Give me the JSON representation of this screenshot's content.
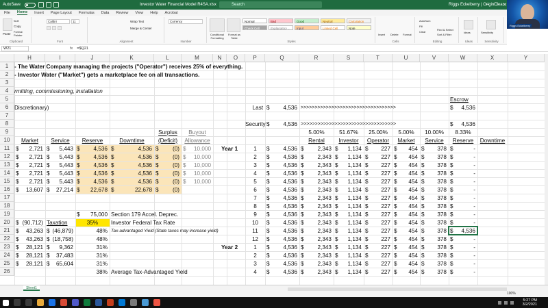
{
  "titlebar": {
    "autosave": "AutoSave",
    "title": "Investor Water Financial Model R4SA.xlsx",
    "search": "Search",
    "user": "Riggs Eckelberry | OriginClear"
  },
  "ribbon": {
    "tabs": [
      "File",
      "Home",
      "Insert",
      "Page Layout",
      "Formulas",
      "Data",
      "Review",
      "View",
      "Help",
      "Acrobat"
    ],
    "groups": [
      "Clipboard",
      "Font",
      "Alignment",
      "Number",
      "Styles",
      "Cells",
      "Editing",
      "Ideas",
      "Sensitivity"
    ],
    "clipboard": {
      "paste": "Paste",
      "cut": "Cut",
      "copy": "Copy",
      "format_painter": "Format Painter"
    },
    "font": {
      "name": "Calibri",
      "size": "11"
    },
    "alignment": {
      "wrap": "Wrap Text",
      "merge": "Merge & Center"
    },
    "number": {
      "format": "Currency"
    },
    "styles": {
      "cond": "Conditional Formatting",
      "table": "Format as Table",
      "normal": "Normal",
      "bad": "Bad",
      "good": "Good",
      "neutral": "Neutral",
      "calculation": "Calculation",
      "check": "Check Cell",
      "explanatory": "Explanatory ...",
      "input": "Input",
      "linked": "Linked Cell",
      "note": "Note"
    },
    "cells": {
      "insert": "Insert",
      "delete": "Delete",
      "format": "Format"
    },
    "editing": {
      "autosum": "AutoSum",
      "fill": "Fill",
      "clear": "Clear",
      "sort": "Sort & Filter",
      "find": "Find & Select"
    },
    "ideas": "Ideas",
    "sensitivity": "Sensitivity"
  },
  "avatar_tag": "Riggs Eckelberry",
  "formula_bar": {
    "name_box": "W21",
    "fx": "fx",
    "formula": "=$Q21"
  },
  "columns": [
    "H",
    "I",
    "J",
    "K",
    "L",
    "M",
    "N",
    "O",
    "P",
    "Q",
    "R",
    "S",
    "T",
    "U",
    "V",
    "W",
    "X",
    "Y"
  ],
  "rows": [
    "1",
    "2",
    "3",
    "4",
    "5",
    "6",
    "7",
    "8",
    "9",
    "10",
    "11",
    "12",
    "13",
    "14",
    "15",
    "16",
    "17",
    "18",
    "19",
    "20",
    "21",
    "22",
    "23",
    "24",
    "25",
    "26"
  ],
  "text": {
    "r1": "- The Water Company managing the projects (\"Operator\") receives 25% of everything.",
    "r2": "- Investor Water (\"Market\") gets a marketplace fee on all transactions.",
    "r4": "rmitting, commissioning, installation",
    "r6": "Discretionary)",
    "escrow": "Escrow",
    "last": "Last",
    "security": "Security",
    "arrows": ">>>>>>>>>>>>>>>>>>>>>>>>>>>>>>>>>>",
    "surplus": "Surplus",
    "deficit": "(Deficit)",
    "buyout": "Buyout",
    "allowance": "Allowance",
    "year1": "Year 1",
    "year2": "Year 2",
    "h_market": "Market",
    "h_service": "Service",
    "h_reserve": "Reserve",
    "h_downtime": "Downtime",
    "section179": "Section 179 Accel. Deprec.",
    "taxation": "Taxation",
    "fed_rate": "Investor Federal Tax Rate",
    "tax_adv": "Tax-advantaged Yield (State taxes may increase yield)",
    "avg_tax": "Average Tax-Advantaged Yield"
  },
  "top_values": {
    "q6": "4,536",
    "v6": "4,536",
    "q8": "4,536",
    "v8": "4,536",
    "pcts": [
      "5.00%",
      "51.67%",
      "25.00%",
      "5.00%",
      "10.00%",
      "8.33%"
    ]
  },
  "right_headers": [
    "Rental",
    "Investor",
    "Operator",
    "Market",
    "Service",
    "Reserve",
    "Downtime"
  ],
  "right_rows": [
    {
      "p": "1",
      "vals": [
        "4,536",
        "2,343",
        "1,134",
        "227",
        "454",
        "378",
        "-"
      ]
    },
    {
      "p": "2",
      "vals": [
        "4,536",
        "2,343",
        "1,134",
        "227",
        "454",
        "378",
        "-"
      ]
    },
    {
      "p": "3",
      "vals": [
        "4,536",
        "2,343",
        "1,134",
        "227",
        "454",
        "378",
        "-"
      ]
    },
    {
      "p": "4",
      "vals": [
        "4,536",
        "2,343",
        "1,134",
        "227",
        "454",
        "378",
        "-"
      ]
    },
    {
      "p": "5",
      "vals": [
        "4,536",
        "2,343",
        "1,134",
        "227",
        "454",
        "378",
        "-"
      ]
    },
    {
      "p": "6",
      "vals": [
        "4,536",
        "2,343",
        "1,134",
        "227",
        "454",
        "378",
        "-"
      ]
    },
    {
      "p": "7",
      "vals": [
        "4,536",
        "2,343",
        "1,134",
        "227",
        "454",
        "378",
        "-"
      ]
    },
    {
      "p": "8",
      "vals": [
        "4,536",
        "2,343",
        "1,134",
        "227",
        "454",
        "378",
        "-"
      ]
    },
    {
      "p": "9",
      "vals": [
        "4,536",
        "2,343",
        "1,134",
        "227",
        "454",
        "378",
        "-"
      ]
    },
    {
      "p": "10",
      "vals": [
        "4,536",
        "2,343",
        "1,134",
        "227",
        "454",
        "378",
        "-"
      ]
    },
    {
      "p": "11",
      "vals": [
        "4,536",
        "2,343",
        "1,134",
        "227",
        "454",
        "378",
        "4,536"
      ]
    },
    {
      "p": "12",
      "vals": [
        "4,536",
        "2,343",
        "1,134",
        "227",
        "454",
        "378",
        "-"
      ]
    },
    {
      "p": "1",
      "vals": [
        "4,536",
        "2,343",
        "1,134",
        "227",
        "454",
        "378",
        "-"
      ]
    },
    {
      "p": "2",
      "vals": [
        "4,536",
        "2,343",
        "1,134",
        "227",
        "454",
        "378",
        "-"
      ]
    },
    {
      "p": "3",
      "vals": [
        "4,536",
        "2,343",
        "1,134",
        "227",
        "454",
        "378",
        "-"
      ]
    },
    {
      "p": "4",
      "vals": [
        "4,536",
        "2,343",
        "1,134",
        "227",
        "454",
        "378",
        "-"
      ]
    }
  ],
  "left_rows": [
    {
      "h": "2,721",
      "i": "5,443",
      "j": "4,536",
      "k": "4,536",
      "l": "(0)",
      "m": "10,000"
    },
    {
      "h": "2,721",
      "i": "5,443",
      "j": "4,536",
      "k": "4,536",
      "l": "(0)",
      "m": "10,000"
    },
    {
      "h": "2,721",
      "i": "5,443",
      "j": "4,536",
      "k": "4,536",
      "l": "(0)",
      "m": "10,000"
    },
    {
      "h": "2,721",
      "i": "5,443",
      "j": "4,536",
      "k": "4,536",
      "l": "(0)",
      "m": "10,000"
    },
    {
      "h": "2,721",
      "i": "5,443",
      "j": "4,536",
      "k": "4,536",
      "l": "(0)",
      "m": "10,000"
    },
    {
      "h": "13,607",
      "i": "27,214",
      "j": "22,678",
      "k": "22,678",
      "l": "(0)",
      "m": ""
    }
  ],
  "lower": {
    "j19": "75,000",
    "h20": "(90,712)",
    "j20": "35%",
    "rows": [
      {
        "h": "43,263",
        "i": "(46,879)",
        "j": "48%"
      },
      {
        "h": "43,263",
        "i": "(18,758)",
        "j": "48%"
      },
      {
        "h": "28,121",
        "i": "9,362",
        "j": "31%"
      },
      {
        "h": "28,121",
        "i": "37,483",
        "j": "31%"
      },
      {
        "h": "28,121",
        "i": "65,604",
        "j": "31%"
      }
    ],
    "j26": "38%"
  },
  "currency": "$",
  "sheet_tab": "Sheet1",
  "zoom": "100%",
  "clock": {
    "time": "5:27 PM",
    "date": "3/2/2021"
  },
  "colors": {
    "excel_green": "#1f6b3f",
    "input_fill": "#fbe5b9",
    "highlight": "#ffe600"
  }
}
